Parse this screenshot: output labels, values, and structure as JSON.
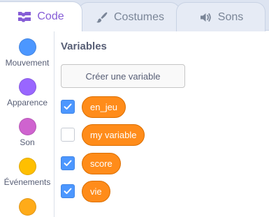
{
  "tabs": [
    {
      "label": "Code",
      "icon": "code-blocks-icon",
      "active": true
    },
    {
      "label": "Costumes",
      "icon": "paintbrush-icon",
      "active": false
    },
    {
      "label": "Sons",
      "icon": "speaker-icon",
      "active": false
    }
  ],
  "categories": [
    {
      "label": "Mouvement",
      "color": "#4c97ff"
    },
    {
      "label": "Apparence",
      "color": "#9966ff"
    },
    {
      "label": "Son",
      "color": "#cf63cf"
    },
    {
      "label": "Événements",
      "color": "#ffbf00"
    },
    {
      "label": "",
      "color": "#ffab19"
    }
  ],
  "palette": {
    "heading": "Variables",
    "create_button": "Créer une variable",
    "variables": [
      {
        "name": "en_jeu",
        "checked": true
      },
      {
        "name": "my variable",
        "checked": false
      },
      {
        "name": "score",
        "checked": true
      },
      {
        "name": "vie",
        "checked": true
      }
    ]
  },
  "colors": {
    "accent": "#855cd6",
    "checkbox": "#4c97ff",
    "variable_block": "#ff8c1a"
  }
}
